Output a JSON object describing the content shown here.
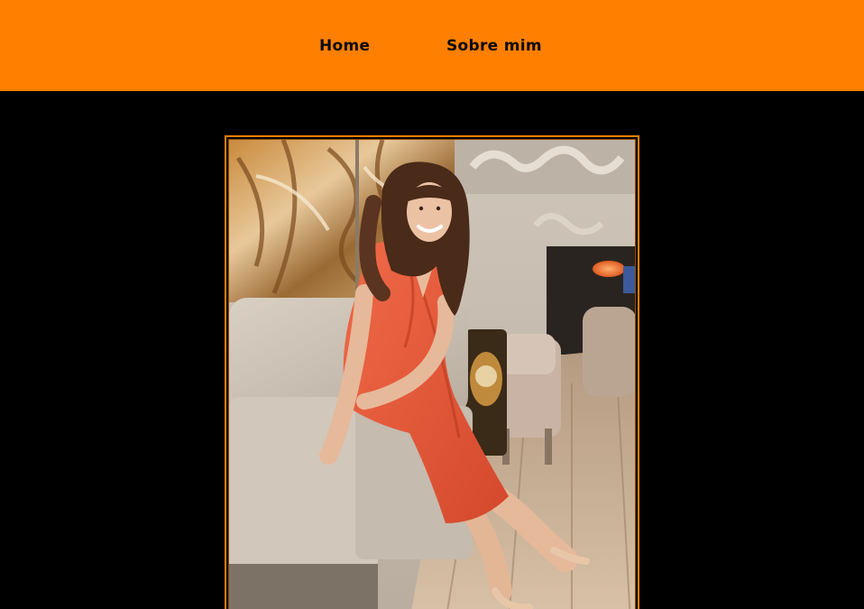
{
  "nav": {
    "items": [
      {
        "label": "Home"
      },
      {
        "label": "Sobre mim"
      }
    ]
  },
  "colors": {
    "accent": "#ff7f00",
    "background": "#000000",
    "nav_text": "#0a0a0a"
  },
  "photo": {
    "subject": "portrait-photo"
  }
}
